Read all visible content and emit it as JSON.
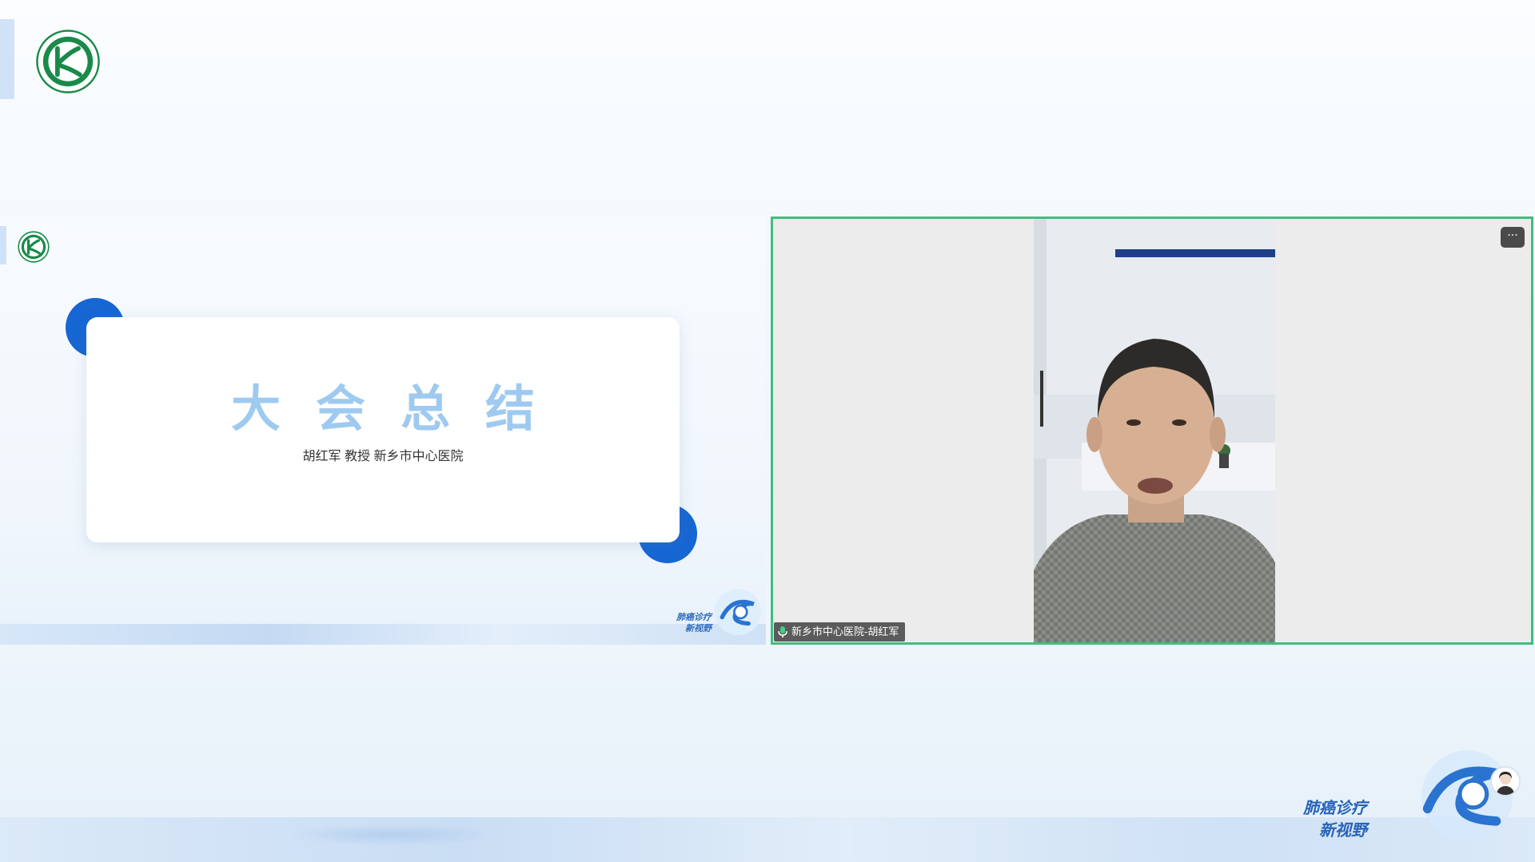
{
  "slide": {
    "title": "大会总结",
    "subtitle": "胡红军 教授 新乡市中心医院"
  },
  "video": {
    "participant_name": "新乡市中心医院-胡红军",
    "more_button": "···"
  },
  "slogan": {
    "line1": "肺癌诊疗",
    "line2": "新视野"
  },
  "icons": {
    "logo": "society-logo-icon",
    "mic": "mic-icon",
    "more": "more-options-icon",
    "emblem": "swirl-emblem-icon",
    "avatar": "user-avatar-icon"
  },
  "colors": {
    "accent_blue": "#1666d3",
    "title_blue": "#9fcaf0",
    "active_speaker_border": "#3fbf7f",
    "logo_green": "#1a8a4a"
  }
}
